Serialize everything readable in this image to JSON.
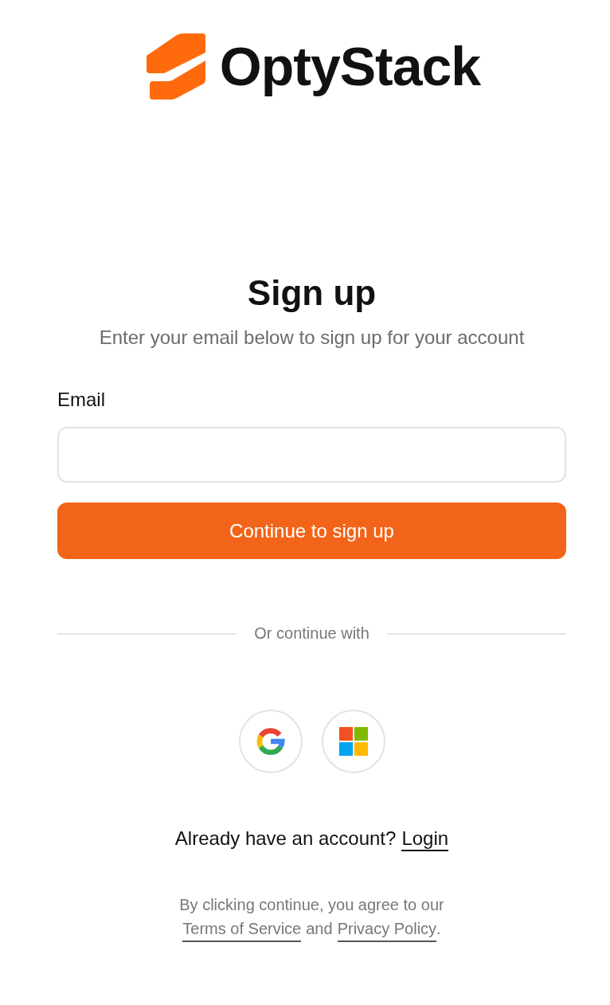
{
  "brand": {
    "name": "OptyStack"
  },
  "heading": "Sign up",
  "subtitle": "Enter your email below to sign up for your account",
  "email_field": {
    "label": "Email"
  },
  "submit_button": "Continue to sign up",
  "divider": "Or continue with",
  "social_buttons": [
    {
      "kind": "google"
    },
    {
      "kind": "microsoft"
    }
  ],
  "login_prompt": {
    "text": "Already have an account?",
    "link": "Login"
  },
  "legal": {
    "line_1": "By clicking continue, you agree to our",
    "terms_link": "Terms of Service",
    "joiner": "and",
    "privacy_link": "Privacy Policy",
    "end": "."
  }
}
